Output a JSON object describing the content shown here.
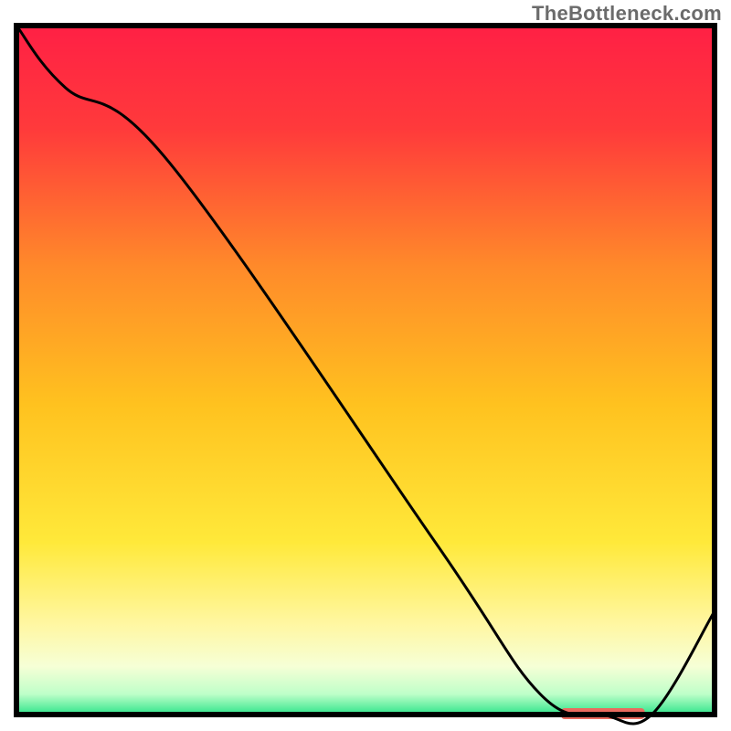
{
  "watermark": "TheBottleneck.com",
  "chart_data": {
    "type": "line",
    "title": "",
    "xlabel": "",
    "ylabel": "",
    "xlim": [
      0,
      100
    ],
    "ylim": [
      0,
      100
    ],
    "grid": false,
    "legend": false,
    "series": [
      {
        "name": "curve",
        "color": "#000000",
        "x": [
          0,
          7,
          22,
          60,
          75,
          84,
          91,
          100
        ],
        "values": [
          100,
          91,
          80,
          25,
          3,
          0,
          0,
          15
        ]
      }
    ],
    "marker": {
      "label": "",
      "x": 84,
      "y": 0,
      "width": 12,
      "color": "#ea6a5e"
    },
    "background": {
      "stops": [
        {
          "offset": 0.0,
          "color": "#ff2045"
        },
        {
          "offset": 0.15,
          "color": "#ff3a3b"
        },
        {
          "offset": 0.35,
          "color": "#ff8a2a"
        },
        {
          "offset": 0.55,
          "color": "#ffc21f"
        },
        {
          "offset": 0.75,
          "color": "#ffe93a"
        },
        {
          "offset": 0.87,
          "color": "#fff7a3"
        },
        {
          "offset": 0.93,
          "color": "#f6ffd6"
        },
        {
          "offset": 0.97,
          "color": "#bfffc9"
        },
        {
          "offset": 1.0,
          "color": "#2fe58b"
        }
      ]
    }
  }
}
